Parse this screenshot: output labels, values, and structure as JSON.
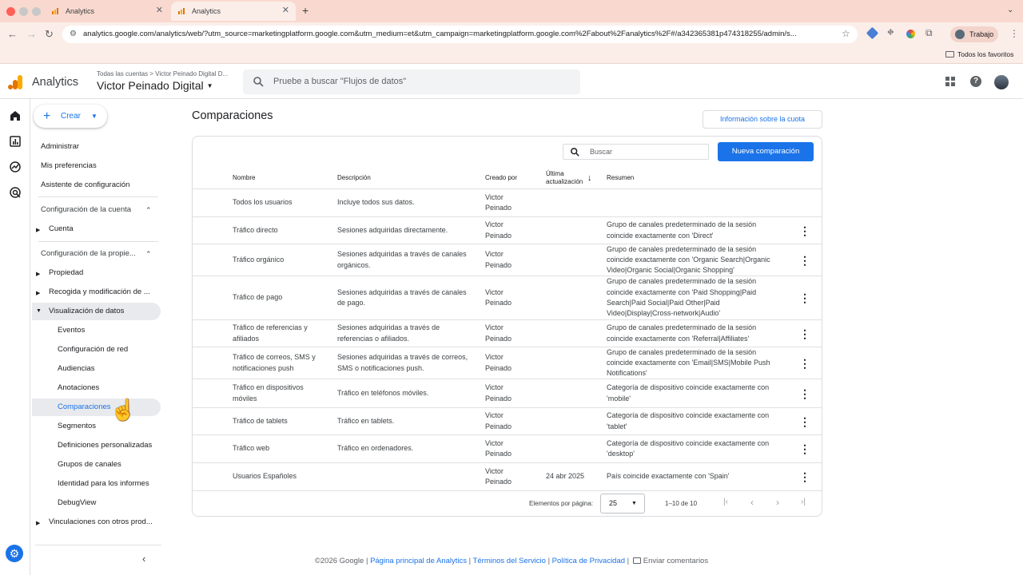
{
  "browser": {
    "tabs": [
      {
        "title": "Analytics",
        "active": false
      },
      {
        "title": "Analytics",
        "active": true
      }
    ],
    "new_tab": "+",
    "url": "analytics.google.com/analytics/web/?utm_source=marketingplatform.google.com&utm_medium=et&utm_campaign=marketingplatform.google.com%2Fabout%2Fanalytics%2F#/a342365381p474318255/admin/s...",
    "profile_label": "Trabajo",
    "bookmarks_label": "Todos los favoritos"
  },
  "header": {
    "app_name": "Analytics",
    "breadcrumb": "Todas las cuentas > Victor Peinado Digital D...",
    "property_name": "Victor Peinado Digital",
    "search_placeholder": "Pruebe a buscar \"Flujos de datos\""
  },
  "sidebar": {
    "create_label": "Crear",
    "admin": "Administrar",
    "prefs": "Mis preferencias",
    "setup": "Asistente de configuración",
    "account_section": "Configuración de la cuenta",
    "account_item": "Cuenta",
    "property_section": "Configuración de la propie...",
    "property_items": [
      "Propiedad",
      "Recogida y modificación de ...",
      "Visualización de datos"
    ],
    "data_display_items": [
      "Eventos",
      "Configuración de red",
      "Audiencias",
      "Anotaciones",
      "Comparaciones",
      "Segmentos",
      "Definiciones personalizadas",
      "Grupos de canales",
      "Identidad para los informes",
      "DebugView"
    ],
    "links_item": "Vinculaciones con otros prod...",
    "selected": "Comparaciones"
  },
  "main": {
    "title": "Comparaciones",
    "quota_button": "Información sobre la cuota",
    "search_placeholder": "Buscar",
    "new_button": "Nueva comparación",
    "columns": {
      "name": "Nombre",
      "description": "Descripción",
      "created_by": "Creado por",
      "updated_1": "Última",
      "updated_2": "actualización",
      "summary": "Resumen"
    },
    "rows": [
      {
        "name": "Todos los usuarios",
        "desc": "Incluye todos sus datos.",
        "by": "Victor Peinado",
        "date": "",
        "summary": "",
        "menu": false
      },
      {
        "name": "Tráfico directo",
        "desc": "Sesiones adquiridas directamente.",
        "by": "Victor Peinado",
        "date": "",
        "summary": "Grupo de canales predeterminado de la sesión coincide exactamente con 'Direct'",
        "menu": true
      },
      {
        "name": "Tráfico orgánico",
        "desc": "Sesiones adquiridas a través de canales orgánicos.",
        "by": "Victor Peinado",
        "date": "",
        "summary": "Grupo de canales predeterminado de la sesión coincide exactamente con 'Organic Search|Organic Video|Organic Social|Organic Shopping'",
        "menu": true
      },
      {
        "name": "Tráfico de pago",
        "desc": "Sesiones adquiridas a través de canales de pago.",
        "by": "Victor Peinado",
        "date": "",
        "summary": "Grupo de canales predeterminado de la sesión coincide exactamente con 'Paid Shopping|Paid Search|Paid Social|Paid Other|Paid Video|Display|Cross-network|Audio'",
        "menu": true
      },
      {
        "name": "Tráfico de referencias y afiliados",
        "desc": "Sesiones adquiridas a través de referencias o afiliados.",
        "by": "Victor Peinado",
        "date": "",
        "summary": "Grupo de canales predeterminado de la sesión coincide exactamente con 'Referral|Affiliates'",
        "menu": true
      },
      {
        "name": "Tráfico de correos, SMS y notificaciones push",
        "desc": "Sesiones adquiridas a través de correos, SMS o notificaciones push.",
        "by": "Victor Peinado",
        "date": "",
        "summary": "Grupo de canales predeterminado de la sesión coincide exactamente con 'Email|SMS|Mobile Push Notifications'",
        "menu": true
      },
      {
        "name": "Tráfico en dispositivos móviles",
        "desc": "Tráfico en teléfonos móviles.",
        "by": "Victor Peinado",
        "date": "",
        "summary": "Categoría de dispositivo coincide exactamente con 'mobile'",
        "menu": true
      },
      {
        "name": "Tráfico de tablets",
        "desc": "Tráfico en tablets.",
        "by": "Victor Peinado",
        "date": "",
        "summary": "Categoría de dispositivo coincide exactamente con 'tablet'",
        "menu": true
      },
      {
        "name": "Tráfico web",
        "desc": "Tráfico en ordenadores.",
        "by": "Victor Peinado",
        "date": "",
        "summary": "Categoría de dispositivo coincide exactamente con 'desktop'",
        "menu": true
      },
      {
        "name": "Usuarios Españoles",
        "desc": "",
        "by": "Victor Peinado",
        "date": "24 abr 2025",
        "summary": "País coincide exactamente con 'Spain'",
        "menu": true
      }
    ],
    "pagination": {
      "label": "Elementos por página:",
      "page_size": "25",
      "range": "1–10 de 10"
    }
  },
  "footer": {
    "copyright": "©2026 Google",
    "home": "Página principal de Analytics",
    "terms": "Términos del Servicio",
    "privacy": "Política de Privacidad",
    "feedback": "Enviar comentarios",
    "sep": "|"
  },
  "colors": {
    "accent": "#1a73e8",
    "tabstrip": "#f9d9cf",
    "selected_nav": "#e8eaed"
  }
}
